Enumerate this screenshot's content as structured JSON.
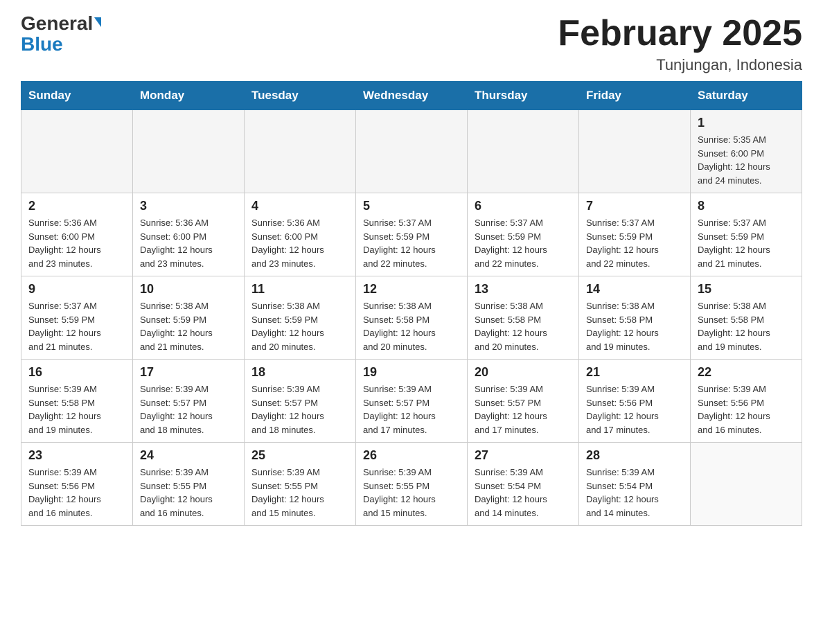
{
  "header": {
    "logo_general": "General",
    "logo_blue": "Blue",
    "title": "February 2025",
    "location": "Tunjungan, Indonesia"
  },
  "days_of_week": [
    "Sunday",
    "Monday",
    "Tuesday",
    "Wednesday",
    "Thursday",
    "Friday",
    "Saturday"
  ],
  "weeks": [
    [
      {
        "day": "",
        "info": ""
      },
      {
        "day": "",
        "info": ""
      },
      {
        "day": "",
        "info": ""
      },
      {
        "day": "",
        "info": ""
      },
      {
        "day": "",
        "info": ""
      },
      {
        "day": "",
        "info": ""
      },
      {
        "day": "1",
        "info": "Sunrise: 5:35 AM\nSunset: 6:00 PM\nDaylight: 12 hours\nand 24 minutes."
      }
    ],
    [
      {
        "day": "2",
        "info": "Sunrise: 5:36 AM\nSunset: 6:00 PM\nDaylight: 12 hours\nand 23 minutes."
      },
      {
        "day": "3",
        "info": "Sunrise: 5:36 AM\nSunset: 6:00 PM\nDaylight: 12 hours\nand 23 minutes."
      },
      {
        "day": "4",
        "info": "Sunrise: 5:36 AM\nSunset: 6:00 PM\nDaylight: 12 hours\nand 23 minutes."
      },
      {
        "day": "5",
        "info": "Sunrise: 5:37 AM\nSunset: 5:59 PM\nDaylight: 12 hours\nand 22 minutes."
      },
      {
        "day": "6",
        "info": "Sunrise: 5:37 AM\nSunset: 5:59 PM\nDaylight: 12 hours\nand 22 minutes."
      },
      {
        "day": "7",
        "info": "Sunrise: 5:37 AM\nSunset: 5:59 PM\nDaylight: 12 hours\nand 22 minutes."
      },
      {
        "day": "8",
        "info": "Sunrise: 5:37 AM\nSunset: 5:59 PM\nDaylight: 12 hours\nand 21 minutes."
      }
    ],
    [
      {
        "day": "9",
        "info": "Sunrise: 5:37 AM\nSunset: 5:59 PM\nDaylight: 12 hours\nand 21 minutes."
      },
      {
        "day": "10",
        "info": "Sunrise: 5:38 AM\nSunset: 5:59 PM\nDaylight: 12 hours\nand 21 minutes."
      },
      {
        "day": "11",
        "info": "Sunrise: 5:38 AM\nSunset: 5:59 PM\nDaylight: 12 hours\nand 20 minutes."
      },
      {
        "day": "12",
        "info": "Sunrise: 5:38 AM\nSunset: 5:58 PM\nDaylight: 12 hours\nand 20 minutes."
      },
      {
        "day": "13",
        "info": "Sunrise: 5:38 AM\nSunset: 5:58 PM\nDaylight: 12 hours\nand 20 minutes."
      },
      {
        "day": "14",
        "info": "Sunrise: 5:38 AM\nSunset: 5:58 PM\nDaylight: 12 hours\nand 19 minutes."
      },
      {
        "day": "15",
        "info": "Sunrise: 5:38 AM\nSunset: 5:58 PM\nDaylight: 12 hours\nand 19 minutes."
      }
    ],
    [
      {
        "day": "16",
        "info": "Sunrise: 5:39 AM\nSunset: 5:58 PM\nDaylight: 12 hours\nand 19 minutes."
      },
      {
        "day": "17",
        "info": "Sunrise: 5:39 AM\nSunset: 5:57 PM\nDaylight: 12 hours\nand 18 minutes."
      },
      {
        "day": "18",
        "info": "Sunrise: 5:39 AM\nSunset: 5:57 PM\nDaylight: 12 hours\nand 18 minutes."
      },
      {
        "day": "19",
        "info": "Sunrise: 5:39 AM\nSunset: 5:57 PM\nDaylight: 12 hours\nand 17 minutes."
      },
      {
        "day": "20",
        "info": "Sunrise: 5:39 AM\nSunset: 5:57 PM\nDaylight: 12 hours\nand 17 minutes."
      },
      {
        "day": "21",
        "info": "Sunrise: 5:39 AM\nSunset: 5:56 PM\nDaylight: 12 hours\nand 17 minutes."
      },
      {
        "day": "22",
        "info": "Sunrise: 5:39 AM\nSunset: 5:56 PM\nDaylight: 12 hours\nand 16 minutes."
      }
    ],
    [
      {
        "day": "23",
        "info": "Sunrise: 5:39 AM\nSunset: 5:56 PM\nDaylight: 12 hours\nand 16 minutes."
      },
      {
        "day": "24",
        "info": "Sunrise: 5:39 AM\nSunset: 5:55 PM\nDaylight: 12 hours\nand 16 minutes."
      },
      {
        "day": "25",
        "info": "Sunrise: 5:39 AM\nSunset: 5:55 PM\nDaylight: 12 hours\nand 15 minutes."
      },
      {
        "day": "26",
        "info": "Sunrise: 5:39 AM\nSunset: 5:55 PM\nDaylight: 12 hours\nand 15 minutes."
      },
      {
        "day": "27",
        "info": "Sunrise: 5:39 AM\nSunset: 5:54 PM\nDaylight: 12 hours\nand 14 minutes."
      },
      {
        "day": "28",
        "info": "Sunrise: 5:39 AM\nSunset: 5:54 PM\nDaylight: 12 hours\nand 14 minutes."
      },
      {
        "day": "",
        "info": ""
      }
    ]
  ]
}
